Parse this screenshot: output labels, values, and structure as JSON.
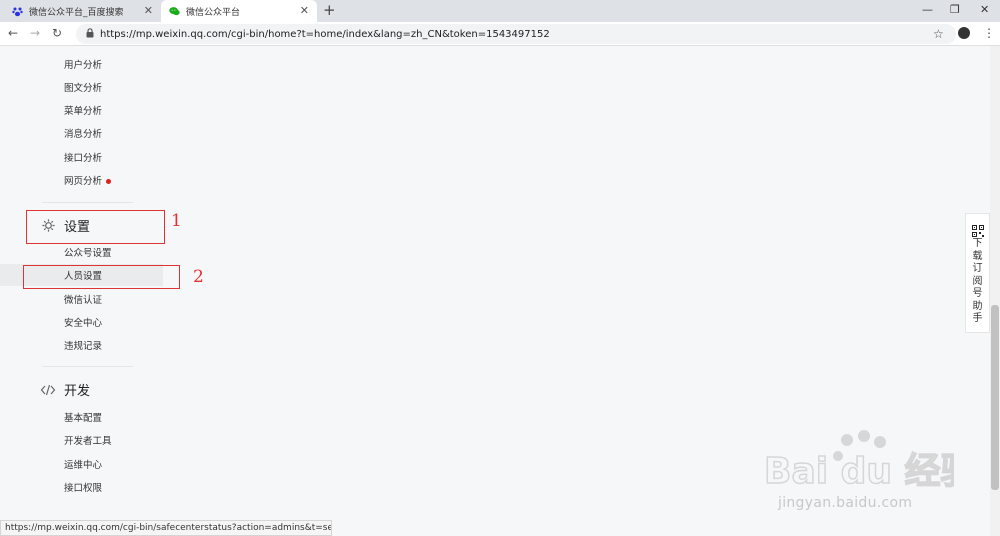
{
  "tabs": [
    {
      "title": "微信公众平台_百度搜索",
      "close": "✕"
    },
    {
      "title": "微信公众平台",
      "close": "✕"
    }
  ],
  "new_tab": "+",
  "window_controls": {
    "minimize": "—",
    "restore": "❐",
    "close": "✕"
  },
  "nav": {
    "back": "←",
    "forward": "→",
    "reload": "↻"
  },
  "url": "https://mp.weixin.qq.com/cgi-bin/home?t=home/index&lang=zh_CN&token=1543497152",
  "bookmark_icon": "☆",
  "menu_icon": "⋮",
  "analytics_items": [
    "用户分析",
    "图文分析",
    "菜单分析",
    "消息分析",
    "接口分析",
    "网页分析"
  ],
  "settings": {
    "title": "设置",
    "items": [
      "公众号设置",
      "人员设置",
      "微信认证",
      "安全中心",
      "违规记录"
    ]
  },
  "dev": {
    "title": "开发",
    "items": [
      "基本配置",
      "开发者工具",
      "运维中心",
      "接口权限"
    ]
  },
  "annotations": {
    "one": "1",
    "two": "2"
  },
  "side_tool": "下载订阅号助手",
  "status_url": "https://mp.weixin.qq.com/cgi-bin/safecenterstatus?action=admins&t=setting/safe-ad...",
  "watermark": {
    "brand": "Bai du 经验",
    "site": "jingyan.baidu.com"
  },
  "colors": {
    "annotation": "#e03434",
    "dot": "#e02020"
  }
}
